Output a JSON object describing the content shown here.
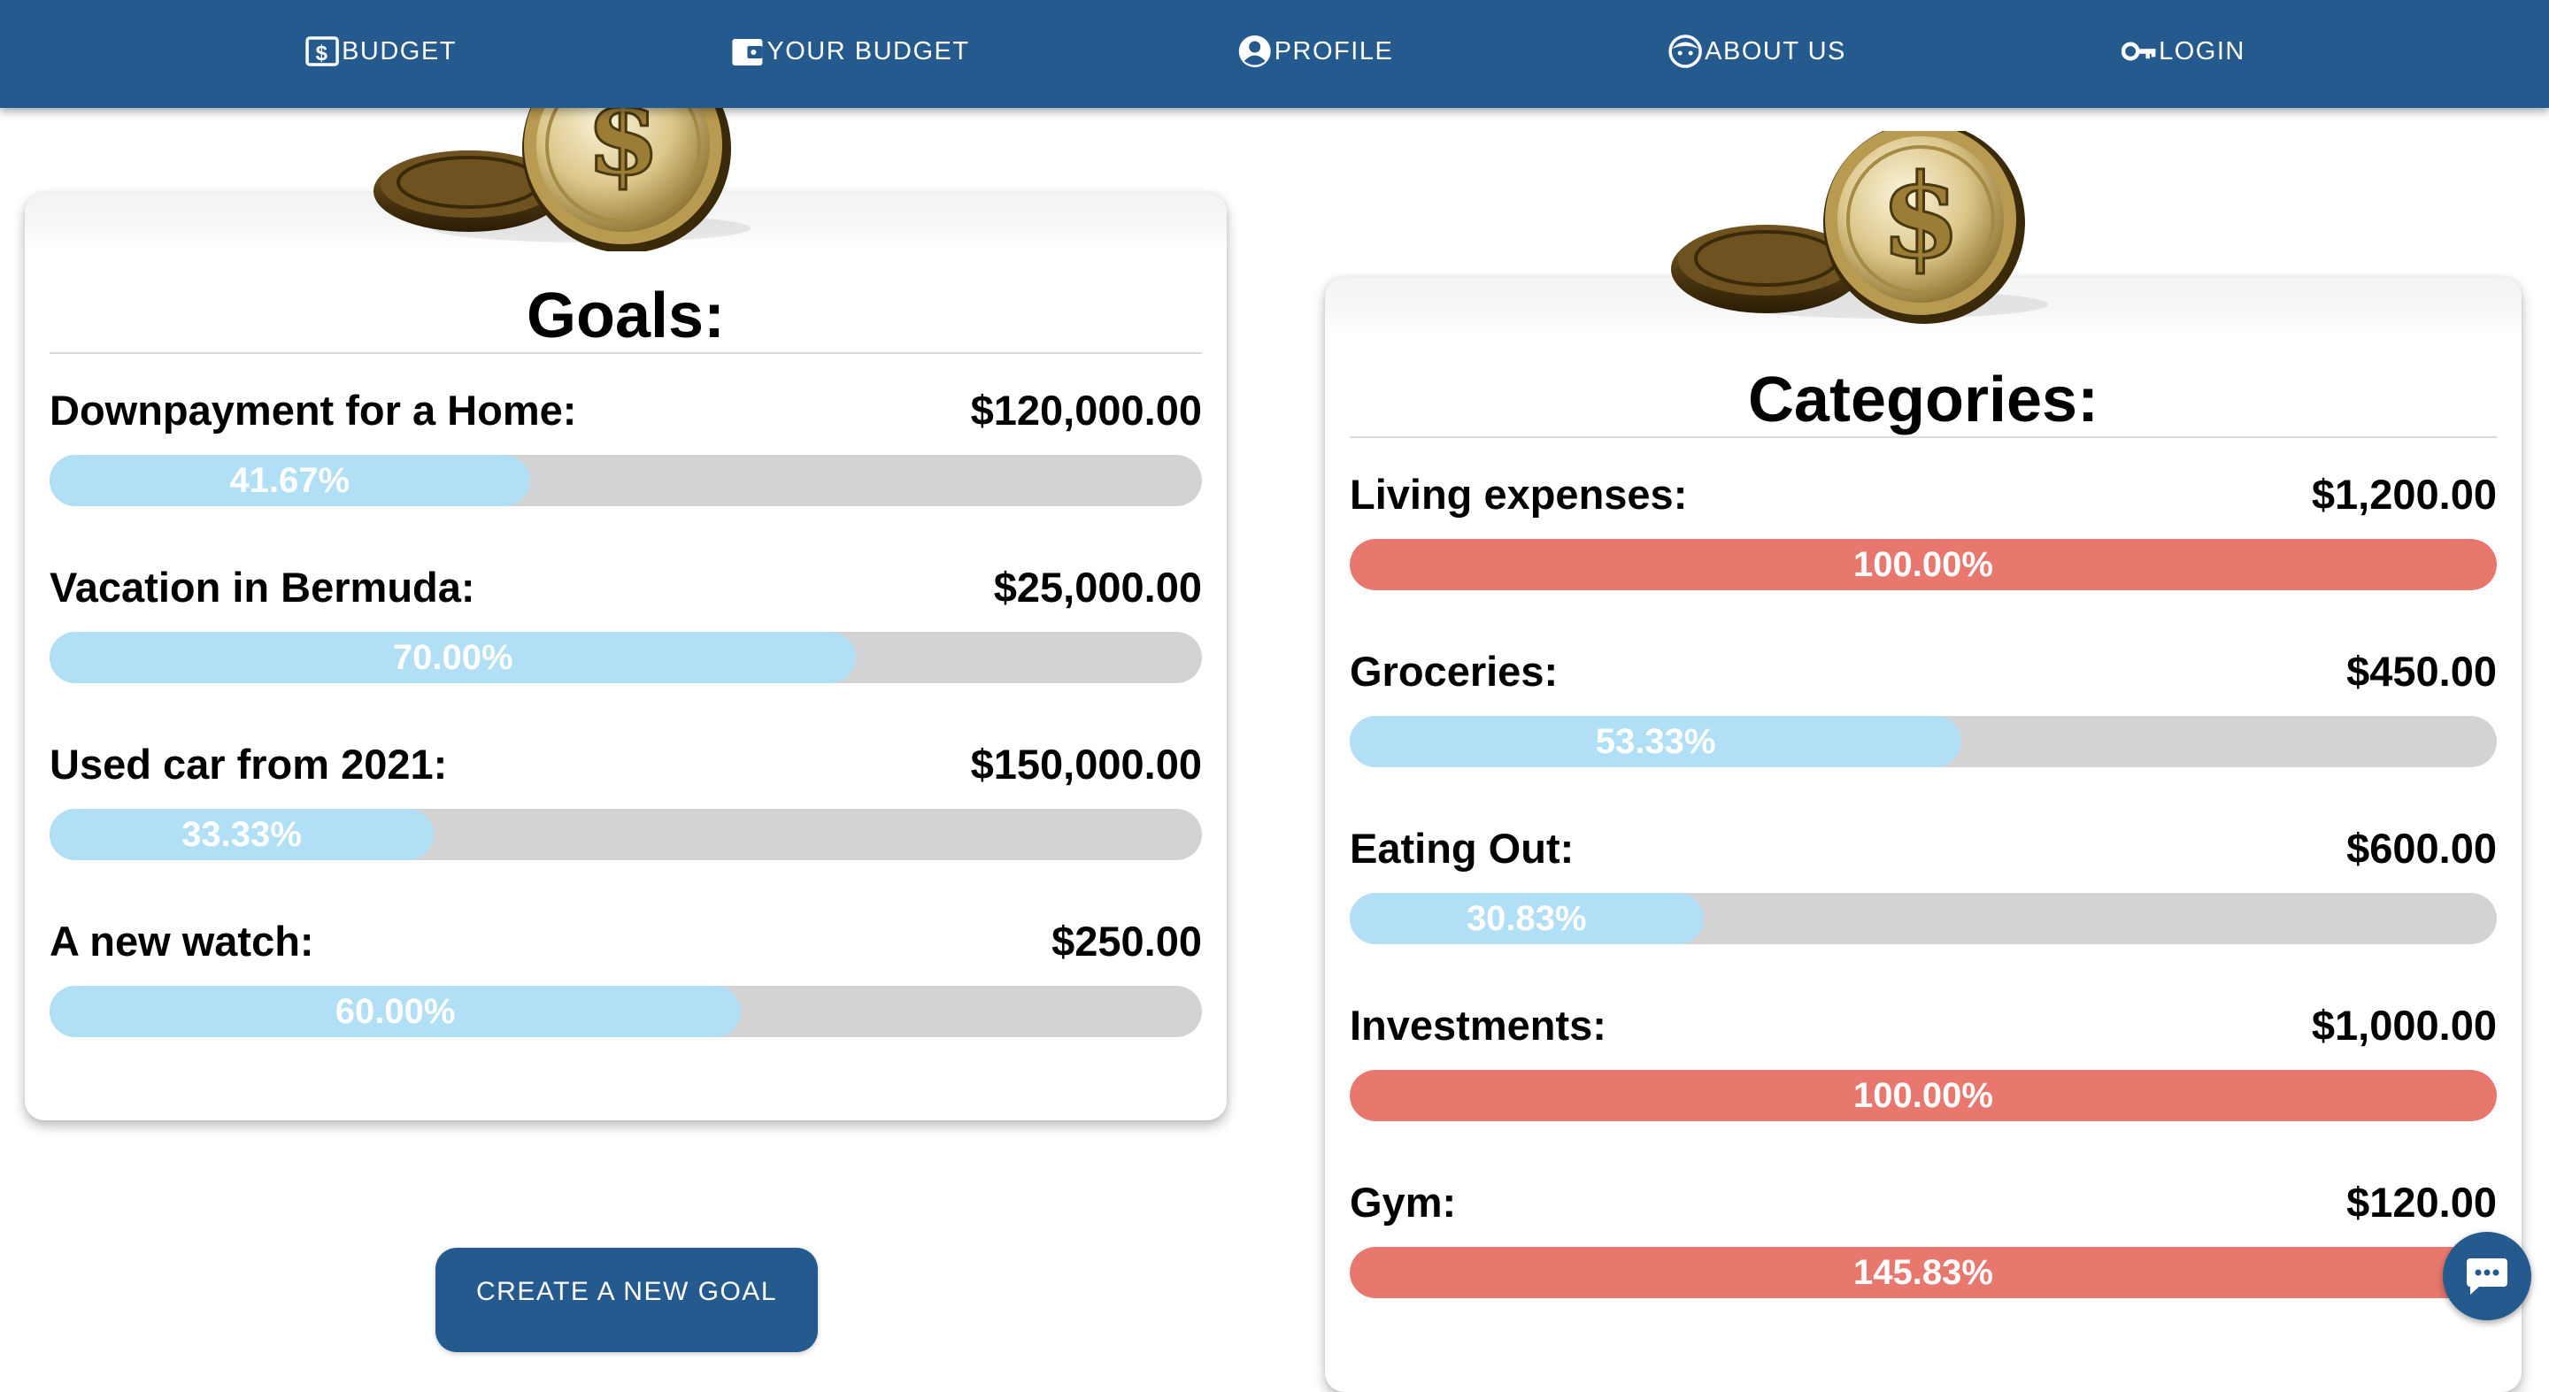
{
  "nav": {
    "items": [
      {
        "label": "BUDGET",
        "icon": "dollar-bill-icon"
      },
      {
        "label": "YOUR BUDGET",
        "icon": "wallet-icon"
      },
      {
        "label": "PROFILE",
        "icon": "user-circle-icon"
      },
      {
        "label": "ABOUT US",
        "icon": "face-icon"
      },
      {
        "label": "LOGIN",
        "icon": "key-icon"
      }
    ]
  },
  "goals": {
    "title": "Goals:",
    "items": [
      {
        "label": "Downpayment for a Home:",
        "amount": "$120,000.00",
        "percent_text": "41.67%",
        "percent": 41.67
      },
      {
        "label": "Vacation in Bermuda:",
        "amount": "$25,000.00",
        "percent_text": "70.00%",
        "percent": 70.0
      },
      {
        "label": "Used car from 2021:",
        "amount": "$150,000.00",
        "percent_text": "33.33%",
        "percent": 33.33
      },
      {
        "label": "A new watch:",
        "amount": "$250.00",
        "percent_text": "60.00%",
        "percent": 60.0
      }
    ],
    "create_button": "CREATE A NEW GOAL"
  },
  "categories": {
    "title": "Categories:",
    "items": [
      {
        "label": "Living expenses:",
        "amount": "$1,200.00",
        "percent_text": "100.00%",
        "percent": 100.0
      },
      {
        "label": "Groceries:",
        "amount": "$450.00",
        "percent_text": "53.33%",
        "percent": 53.33
      },
      {
        "label": "Eating Out:",
        "amount": "$600.00",
        "percent_text": "30.83%",
        "percent": 30.83
      },
      {
        "label": "Investments:",
        "amount": "$1,000.00",
        "percent_text": "100.00%",
        "percent": 100.0
      },
      {
        "label": "Gym:",
        "amount": "$120.00",
        "percent_text": "145.83%",
        "percent": 145.83
      }
    ]
  },
  "colors": {
    "nav_bg": "#245a8d",
    "bar_track": "#d3d3d3",
    "bar_under": "#b1dff6",
    "bar_over": "#e8786e"
  },
  "chat": {
    "icon": "chat-bubble-icon"
  }
}
